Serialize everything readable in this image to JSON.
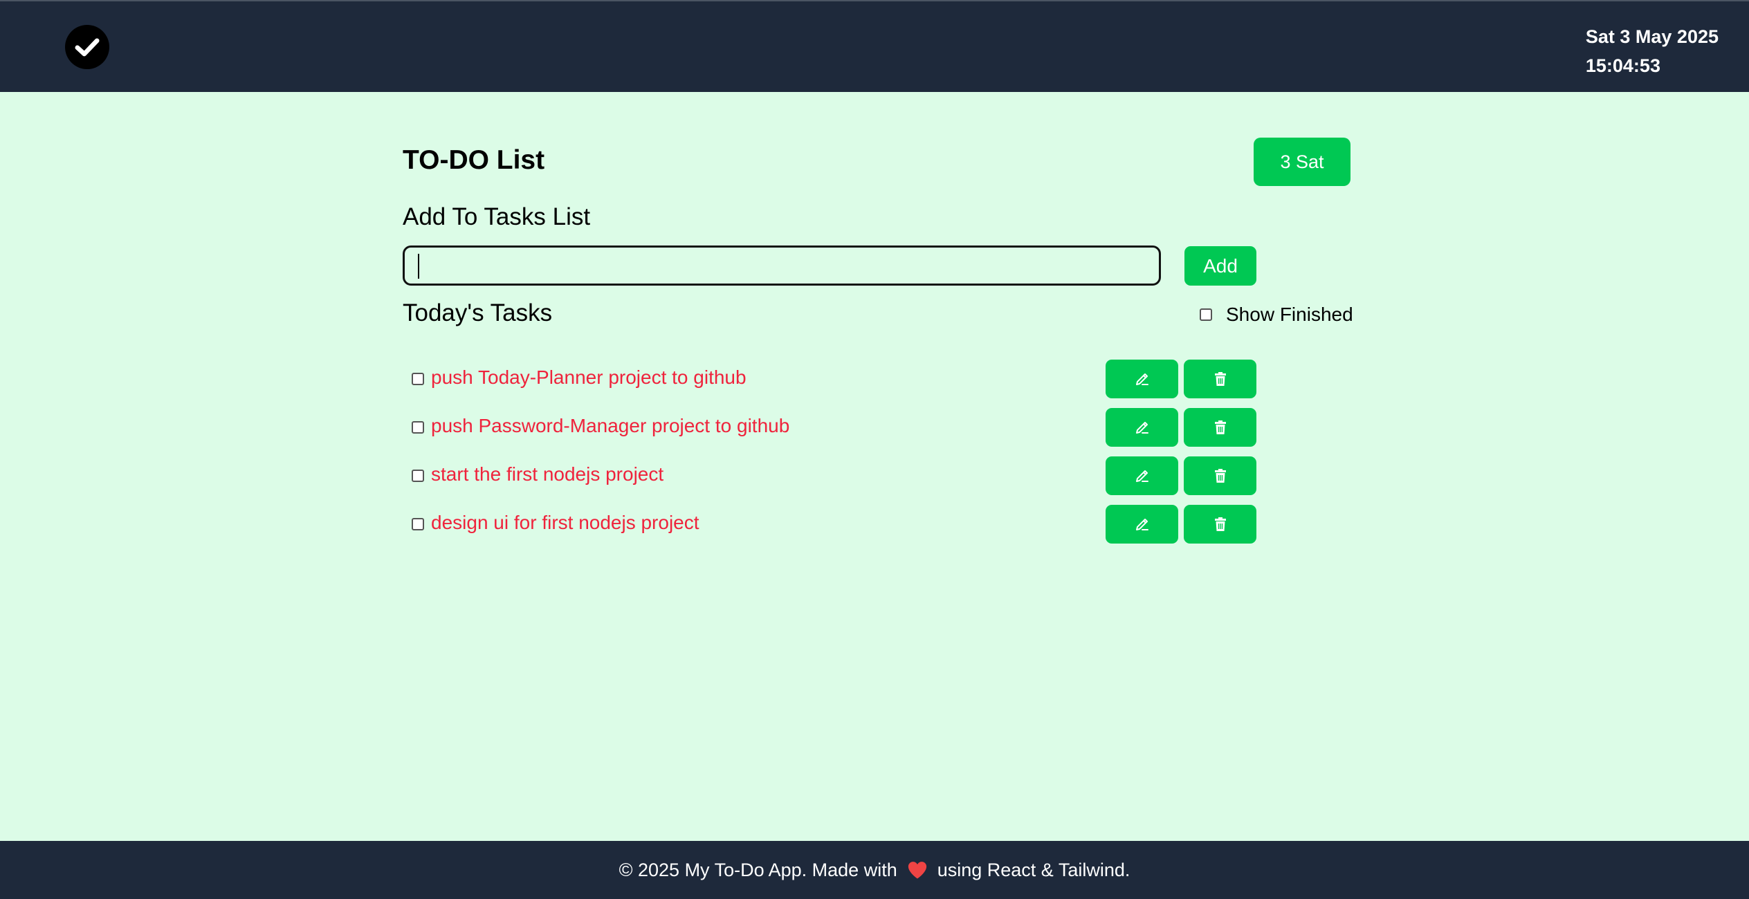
{
  "header": {
    "logo_icon": "checkmark-circle-icon",
    "date": "Sat 3 May 2025",
    "time": "15:04:53"
  },
  "main": {
    "title": "TO-DO List",
    "day_button_label": "3 Sat",
    "add_heading": "Add To Tasks List",
    "input_value": "",
    "add_button_label": "Add",
    "today_heading": "Today's Tasks",
    "show_finished_label": "Show Finished",
    "show_finished_checked": false
  },
  "tasks": [
    {
      "text": "push Today-Planner project to github",
      "done": false
    },
    {
      "text": "push Password-Manager project to github",
      "done": false
    },
    {
      "text": "start the first nodejs project",
      "done": false
    },
    {
      "text": "design ui for first nodejs project",
      "done": false
    }
  ],
  "task_actions": {
    "edit_icon": "edit-icon",
    "delete_icon": "trash-icon"
  },
  "footer": {
    "text_before": "© 2025 My To-Do App. Made with",
    "heart_icon": "heart-icon",
    "text_after": "using React & Tailwind."
  },
  "colors": {
    "header_bg": "#1e293b",
    "page_bg": "#dcfce7",
    "accent": "#00c853",
    "task_text": "#ef233c"
  }
}
